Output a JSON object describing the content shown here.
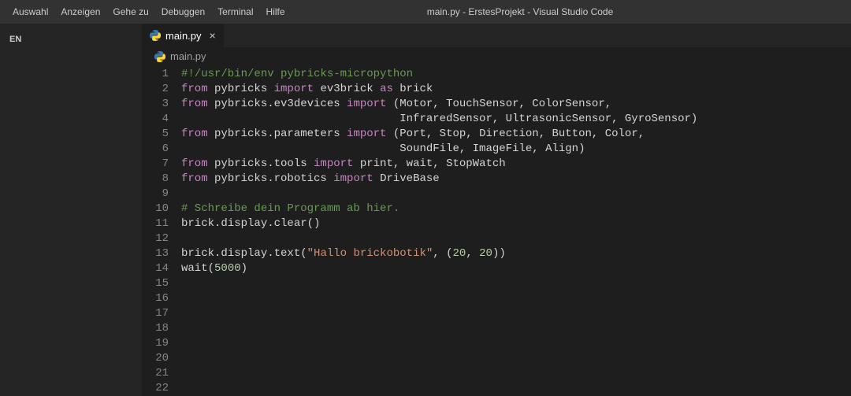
{
  "window_title": "main.py - ErstesProjekt - Visual Studio Code",
  "menu": [
    "Auswahl",
    "Anzeigen",
    "Gehe zu",
    "Debuggen",
    "Terminal",
    "Hilfe"
  ],
  "sidebar": {
    "section_label": "EN"
  },
  "tab": {
    "filename": "main.py",
    "icon": "python"
  },
  "breadcrumb": {
    "filename": "main.py",
    "icon": "python"
  },
  "editor": {
    "line_count": 22,
    "lines": [
      {
        "n": 1,
        "tokens": [
          {
            "t": "comment",
            "v": "#!/usr/bin/env pybricks-micropython"
          }
        ]
      },
      {
        "n": 2,
        "tokens": [
          {
            "t": "keyword",
            "v": "from"
          },
          {
            "t": "ident",
            "v": " pybricks "
          },
          {
            "t": "keyword",
            "v": "import"
          },
          {
            "t": "ident",
            "v": " ev3brick "
          },
          {
            "t": "keyword",
            "v": "as"
          },
          {
            "t": "ident",
            "v": " brick"
          }
        ]
      },
      {
        "n": 3,
        "tokens": [
          {
            "t": "keyword",
            "v": "from"
          },
          {
            "t": "ident",
            "v": " pybricks.ev3devices "
          },
          {
            "t": "keyword",
            "v": "import"
          },
          {
            "t": "ident",
            "v": " (Motor, TouchSensor, ColorSensor,"
          }
        ]
      },
      {
        "n": 4,
        "tokens": [
          {
            "t": "ident",
            "v": "                                 InfraredSensor, UltrasonicSensor, GyroSensor)"
          }
        ]
      },
      {
        "n": 5,
        "tokens": [
          {
            "t": "keyword",
            "v": "from"
          },
          {
            "t": "ident",
            "v": " pybricks.parameters "
          },
          {
            "t": "keyword",
            "v": "import"
          },
          {
            "t": "ident",
            "v": " (Port, Stop, Direction, Button, Color,"
          }
        ]
      },
      {
        "n": 6,
        "tokens": [
          {
            "t": "ident",
            "v": "                                 SoundFile, ImageFile, Align)"
          }
        ]
      },
      {
        "n": 7,
        "tokens": [
          {
            "t": "keyword",
            "v": "from"
          },
          {
            "t": "ident",
            "v": " pybricks.tools "
          },
          {
            "t": "keyword",
            "v": "import"
          },
          {
            "t": "ident",
            "v": " print, wait, StopWatch"
          }
        ]
      },
      {
        "n": 8,
        "tokens": [
          {
            "t": "keyword",
            "v": "from"
          },
          {
            "t": "ident",
            "v": " pybricks.robotics "
          },
          {
            "t": "keyword",
            "v": "import"
          },
          {
            "t": "ident",
            "v": " DriveBase"
          }
        ]
      },
      {
        "n": 9,
        "tokens": []
      },
      {
        "n": 10,
        "tokens": [
          {
            "t": "comment",
            "v": "# Schreibe dein Programm ab hier."
          }
        ]
      },
      {
        "n": 11,
        "tokens": [
          {
            "t": "ident",
            "v": "brick.display.clear()"
          }
        ]
      },
      {
        "n": 12,
        "tokens": []
      },
      {
        "n": 13,
        "tokens": [
          {
            "t": "ident",
            "v": "brick.display.text("
          },
          {
            "t": "string",
            "v": "\"Hallo brickobotik\""
          },
          {
            "t": "ident",
            "v": ", ("
          },
          {
            "t": "number",
            "v": "20"
          },
          {
            "t": "ident",
            "v": ", "
          },
          {
            "t": "number",
            "v": "20"
          },
          {
            "t": "ident",
            "v": "))"
          }
        ]
      },
      {
        "n": 14,
        "tokens": [
          {
            "t": "ident",
            "v": "wait("
          },
          {
            "t": "number",
            "v": "5000"
          },
          {
            "t": "ident",
            "v": ")"
          }
        ]
      },
      {
        "n": 15,
        "tokens": []
      },
      {
        "n": 16,
        "tokens": []
      },
      {
        "n": 17,
        "tokens": []
      },
      {
        "n": 18,
        "tokens": []
      },
      {
        "n": 19,
        "tokens": []
      },
      {
        "n": 20,
        "tokens": []
      },
      {
        "n": 21,
        "tokens": []
      },
      {
        "n": 22,
        "tokens": []
      }
    ]
  }
}
